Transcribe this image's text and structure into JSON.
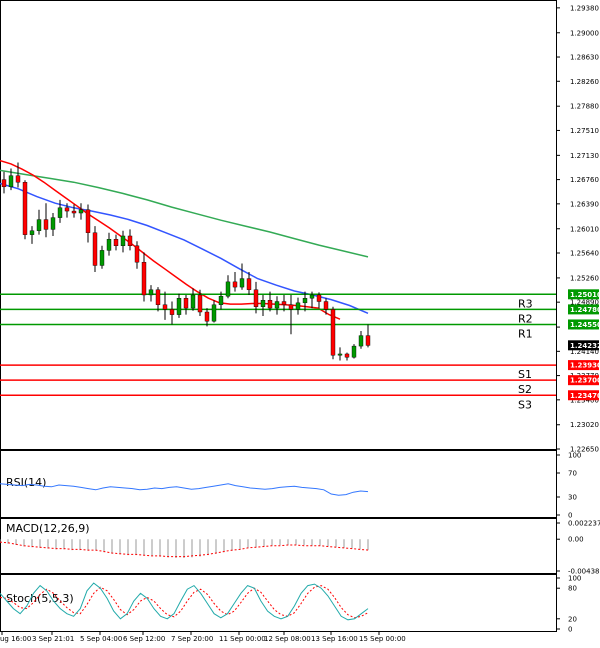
{
  "chart_data": [
    {
      "type": "candlestick",
      "title": "",
      "y_ticks": [
        "1.29380",
        "1.29000",
        "1.28630",
        "1.28260",
        "1.27880",
        "1.27510",
        "1.27130",
        "1.26760",
        "1.26390",
        "1.26010",
        "1.25640",
        "1.25260",
        "1.24890",
        "1.24510",
        "1.24140",
        "1.23770",
        "1.23400",
        "1.23020",
        "1.22650"
      ],
      "x_ticks": [
        "ug 16:00",
        "3 Sep 21:01",
        "5 Sep 04:00",
        "6 Sep 12:00",
        "7 Sep 20:00",
        "11 Sep 00:00",
        "12 Sep 08:00",
        "13 Sep 16:00",
        "15 Sep 00:00"
      ],
      "ylim": [
        1.2265,
        1.295
      ],
      "current_price": "1.24232",
      "colors": {
        "up": "#009900",
        "down": "#ff0000",
        "ma_fast": "#ff0000",
        "ma_mid": "#3355ff",
        "ma_slow": "#33aa55",
        "resistance": "#009900",
        "support": "#ff0000"
      },
      "levels": [
        {
          "name": "R3",
          "value": 1.2501,
          "label": "1.25010",
          "kind": "resistance"
        },
        {
          "name": "R2",
          "value": 1.2478,
          "label": "1.24780",
          "kind": "resistance"
        },
        {
          "name": "R1",
          "value": 1.2455,
          "label": "1.24550",
          "kind": "resistance"
        },
        {
          "name": "S1",
          "value": 1.2393,
          "label": "1.23930",
          "kind": "support"
        },
        {
          "name": "S2",
          "value": 1.237,
          "label": "1.23700",
          "kind": "support"
        },
        {
          "name": "S3",
          "value": 1.2347,
          "label": "1.23470",
          "kind": "support"
        }
      ],
      "candles": [
        [
          1.2676,
          1.2688,
          1.2655,
          1.2665
        ],
        [
          1.2665,
          1.2693,
          1.266,
          1.2682
        ],
        [
          1.2682,
          1.2702,
          1.2664,
          1.2672
        ],
        [
          1.2672,
          1.2675,
          1.2585,
          1.2592
        ],
        [
          1.2592,
          1.2605,
          1.2578,
          1.2598
        ],
        [
          1.2598,
          1.263,
          1.2592,
          1.2615
        ],
        [
          1.2615,
          1.264,
          1.2588,
          1.26
        ],
        [
          1.26,
          1.2625,
          1.259,
          1.2618
        ],
        [
          1.2618,
          1.2645,
          1.261,
          1.2633
        ],
        [
          1.2633,
          1.264,
          1.2618,
          1.2628
        ],
        [
          1.2628,
          1.2638,
          1.2618,
          1.2625
        ],
        [
          1.2625,
          1.264,
          1.2615,
          1.263
        ],
        [
          1.263,
          1.2638,
          1.258,
          1.2595
        ],
        [
          1.2595,
          1.2605,
          1.2535,
          1.2545
        ],
        [
          1.2545,
          1.2575,
          1.254,
          1.2568
        ],
        [
          1.2568,
          1.2595,
          1.256,
          1.2585
        ],
        [
          1.2585,
          1.2592,
          1.2568,
          1.2575
        ],
        [
          1.2575,
          1.2598,
          1.2565,
          1.259
        ],
        [
          1.259,
          1.26,
          1.2568,
          1.2575
        ],
        [
          1.2575,
          1.2582,
          1.254,
          1.255
        ],
        [
          1.255,
          1.2565,
          1.249,
          1.25
        ],
        [
          1.25,
          1.2515,
          1.249,
          1.2508
        ],
        [
          1.2508,
          1.2512,
          1.2475,
          1.2485
        ],
        [
          1.2485,
          1.2505,
          1.2462,
          1.2478
        ],
        [
          1.2478,
          1.249,
          1.2455,
          1.247
        ],
        [
          1.247,
          1.2502,
          1.2465,
          1.2495
        ],
        [
          1.2495,
          1.25,
          1.247,
          1.248
        ],
        [
          1.248,
          1.251,
          1.2476,
          1.25
        ],
        [
          1.25,
          1.2508,
          1.2468,
          1.2474
        ],
        [
          1.2474,
          1.248,
          1.2452,
          1.246
        ],
        [
          1.246,
          1.2492,
          1.2458,
          1.2485
        ],
        [
          1.2485,
          1.2505,
          1.2478,
          1.2498
        ],
        [
          1.2498,
          1.253,
          1.2495,
          1.252
        ],
        [
          1.252,
          1.2535,
          1.2505,
          1.2512
        ],
        [
          1.2512,
          1.2548,
          1.2508,
          1.2525
        ],
        [
          1.2525,
          1.2535,
          1.25,
          1.2508
        ],
        [
          1.2508,
          1.252,
          1.2472,
          1.2482
        ],
        [
          1.2482,
          1.25,
          1.2468,
          1.2492
        ],
        [
          1.2492,
          1.2505,
          1.2475,
          1.248
        ],
        [
          1.248,
          1.2498,
          1.247,
          1.249
        ],
        [
          1.249,
          1.25,
          1.2475,
          1.2485
        ],
        [
          1.2485,
          1.25,
          1.244,
          1.2478
        ],
        [
          1.2478,
          1.2496,
          1.247,
          1.2488
        ],
        [
          1.2488,
          1.2505,
          1.2475,
          1.2495
        ],
        [
          1.2495,
          1.2505,
          1.248,
          1.25
        ],
        [
          1.25,
          1.2504,
          1.248,
          1.249
        ],
        [
          1.249,
          1.2495,
          1.247,
          1.2478
        ],
        [
          1.2478,
          1.2482,
          1.2402,
          1.2408
        ],
        [
          1.2408,
          1.242,
          1.24,
          1.241
        ],
        [
          1.241,
          1.2412,
          1.24,
          1.2405
        ],
        [
          1.2405,
          1.2425,
          1.2403,
          1.2422
        ],
        [
          1.2422,
          1.2445,
          1.2418,
          1.2438
        ],
        [
          1.2438,
          1.2455,
          1.242,
          1.2423
        ]
      ],
      "ma_fast": [
        1.2705,
        1.27,
        1.2692,
        1.2683,
        1.2672,
        1.266,
        1.2648,
        1.2636,
        1.2624,
        1.2613,
        1.2602,
        1.259,
        1.2578,
        1.2565,
        1.2552,
        1.254,
        1.2528,
        1.2516,
        1.2505,
        1.2495,
        1.2488,
        1.2486,
        1.2486,
        1.2487,
        1.2487,
        1.2486,
        1.2485,
        1.2484,
        1.2482,
        1.248,
        1.247,
        1.2463
      ],
      "ma_mid": [
        1.267,
        1.2662,
        1.265,
        1.264,
        1.2633,
        1.2628,
        1.2622,
        1.2615,
        1.2606,
        1.2595,
        1.2584,
        1.257,
        1.2556,
        1.254,
        1.2525,
        1.2515,
        1.2506,
        1.25,
        1.2493,
        1.2484,
        1.2472
      ],
      "ma_slow": [
        1.269,
        1.2684,
        1.2678,
        1.2672,
        1.2664,
        1.2655,
        1.2645,
        1.2634,
        1.2624,
        1.2614,
        1.2605,
        1.2596,
        1.2586,
        1.2576,
        1.2567,
        1.2558
      ],
      "series_names": []
    },
    {
      "type": "line",
      "title": "RSI(14)",
      "ylim": [
        0,
        100
      ],
      "y_ticks": [
        "100",
        "70",
        "30",
        "0"
      ],
      "values": [
        52,
        51,
        50,
        49,
        51,
        50,
        48,
        47,
        50,
        49,
        48,
        46,
        44,
        42,
        45,
        47,
        46,
        45,
        44,
        42,
        43,
        45,
        44,
        46,
        47,
        45,
        43,
        44,
        46,
        48,
        50,
        52,
        49,
        47,
        45,
        44,
        43,
        44,
        46,
        47,
        48,
        46,
        45,
        44,
        42,
        35,
        33,
        34,
        38,
        40,
        39
      ]
    },
    {
      "type": "bar",
      "title": "MACD(12,26,9)",
      "ylim": [
        -0.004385,
        0.002237
      ],
      "y_ticks": [
        "0.002237",
        "0.00",
        "-0.004385"
      ],
      "values": [
        -0.0005,
        -0.0006,
        -0.0008,
        -0.001,
        -0.0011,
        -0.0012,
        -0.0013,
        -0.0014,
        -0.0014,
        -0.0015,
        -0.0015,
        -0.0016,
        -0.0016,
        -0.0018,
        -0.002,
        -0.0021,
        -0.0022,
        -0.0022,
        -0.0022,
        -0.0023,
        -0.0024,
        -0.0025,
        -0.0026,
        -0.0026,
        -0.0025,
        -0.0024,
        -0.0022,
        -0.002,
        -0.0018,
        -0.0016,
        -0.0014,
        -0.0012,
        -0.0011,
        -0.001,
        -0.0009,
        -0.0008,
        -0.0008,
        -0.0008,
        -0.0008,
        -0.0009,
        -0.0009,
        -0.001,
        -0.0011,
        -0.0012,
        -0.0013,
        -0.0014,
        -0.0015
      ],
      "signal": [
        -0.0004,
        -0.0005,
        -0.0007,
        -0.0009,
        -0.001,
        -0.0011,
        -0.0012,
        -0.0013,
        -0.0013,
        -0.0014,
        -0.0014,
        -0.0015,
        -0.0015,
        -0.0017,
        -0.0019,
        -0.002,
        -0.0021,
        -0.0021,
        -0.0022,
        -0.0023,
        -0.0023,
        -0.0024,
        -0.0024,
        -0.0024,
        -0.0023,
        -0.0022,
        -0.0021,
        -0.0019,
        -0.0017,
        -0.0015,
        -0.0014,
        -0.0012,
        -0.0011,
        -0.001,
        -0.0009,
        -0.0009,
        -0.0008,
        -0.0008,
        -0.0009,
        -0.0009,
        -0.0009,
        -0.001,
        -0.0011,
        -0.0012,
        -0.0013,
        -0.0014,
        -0.0015
      ]
    },
    {
      "type": "line",
      "title": "Stoch(5,5,3)",
      "ylim": [
        0,
        100
      ],
      "y_ticks": [
        "100",
        "80",
        "20",
        "0"
      ],
      "main": [
        70,
        55,
        40,
        30,
        45,
        70,
        85,
        75,
        55,
        40,
        30,
        25,
        40,
        75,
        90,
        80,
        60,
        35,
        20,
        30,
        55,
        70,
        60,
        40,
        25,
        20,
        30,
        55,
        78,
        85,
        70,
        50,
        30,
        22,
        30,
        50,
        70,
        85,
        80,
        55,
        35,
        25,
        20,
        25,
        45,
        70,
        85,
        88,
        80,
        65,
        45,
        25,
        18,
        20,
        30,
        40
      ],
      "signal": [
        62,
        60,
        52,
        42,
        40,
        52,
        68,
        78,
        70,
        55,
        42,
        32,
        30,
        48,
        70,
        82,
        75,
        58,
        38,
        28,
        38,
        55,
        62,
        55,
        40,
        28,
        24,
        35,
        55,
        72,
        78,
        68,
        50,
        35,
        28,
        35,
        52,
        70,
        80,
        72,
        55,
        38,
        28,
        25,
        32,
        50,
        70,
        82,
        85,
        78,
        62,
        42,
        28,
        22,
        25,
        32
      ]
    }
  ]
}
